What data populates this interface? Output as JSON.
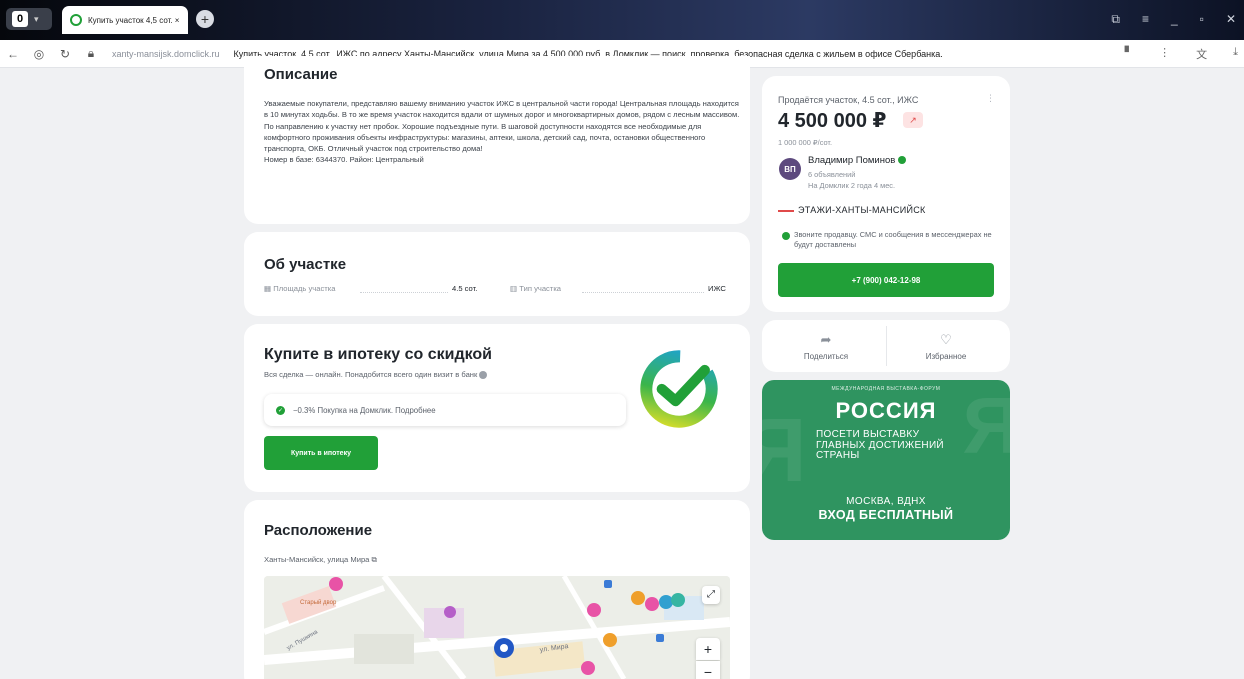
{
  "browser": {
    "tab_title": "Купить участок 4,5 сот. ×",
    "tab_badge": "0",
    "url_host": "xanty-mansijsk.domclick.ru",
    "url_title": "Купить участок, 4.5 сот., ИЖС по адресу Ханты-Мансийск, улица Мира за 4 500 000 руб. в Домклик — поиск, проверка, безопасная сделка с жильем в офисе Сбербанка."
  },
  "description": {
    "title": "Описание",
    "text": "Уважаемые покупатели, представляю вашему вниманию участок ИЖС в центральной части города! Центральная площадь находится в 10 минутах ходьбы. В то же время участок находится вдали от шумных дорог и многоквартирных домов, рядом с лесным массивом. По направлению к участку нет пробок. Хорошие подъездные пути. В шаговой доступности находятся все необходимые для комфортного проживания объекты инфраструктуры: магазины, аптеки, школа, детский сад, почта, остановки общественного транспорта, ОКБ. Отличный участок под строительство дома!",
    "base": "Номер в базе: 6344370. Район: Центральный"
  },
  "about": {
    "title": "Об участке",
    "area_label": "Площадь участка",
    "area_value": "4.5 сот.",
    "type_label": "Тип участка",
    "type_value": "ИЖС"
  },
  "mortgage": {
    "title": "Купите в ипотеку со скидкой",
    "subtitle": "Вся сделка — онлайн. Понадобится всего один визит в банк",
    "discount": "−0.3% Покупка на Домклик. Подробнее",
    "button": "Купить в ипотеку"
  },
  "location": {
    "title": "Расположение",
    "address": "Ханты-Мансийск, улица Мира",
    "street1": "ул. Мира",
    "street2": "ул. Пушкина"
  },
  "offer": {
    "title": "Продаётся участок, 4.5 сот., ИЖС",
    "price": "4 500 000 ₽",
    "price_per": "1 000 000 ₽/сот.",
    "seller_initials": "ВП",
    "seller_name": "Владимир Поминов",
    "seller_ads": "6 объявлений",
    "seller_since": "На Домклик 2 года 4 мес.",
    "agency": "ЭТАЖИ-ХАНТЫ-МАНСИЙСК",
    "notice": "Звоните продавцу. СМС и сообщения в мессенджерах не будут доставлены",
    "phone": "+7 (900) 042-12-98",
    "share": "Поделиться",
    "favorite": "Избранное"
  },
  "banner": {
    "top": "МЕЖДУНАРОДНАЯ ВЫСТАВКА-ФОРУМ",
    "logo": "РОССИЯ",
    "line1": "ПОСЕТИ ВЫСТАВКУ",
    "line2": "ГЛАВНЫХ ДОСТИЖЕНИЙ",
    "line3": "СТРАНЫ",
    "city": "МОСКВА, ВДНХ",
    "free": "ВХОД БЕСПЛАТНЫЙ"
  },
  "colors": {
    "brand": "#21a038",
    "accent_red": "#e04a4a"
  }
}
